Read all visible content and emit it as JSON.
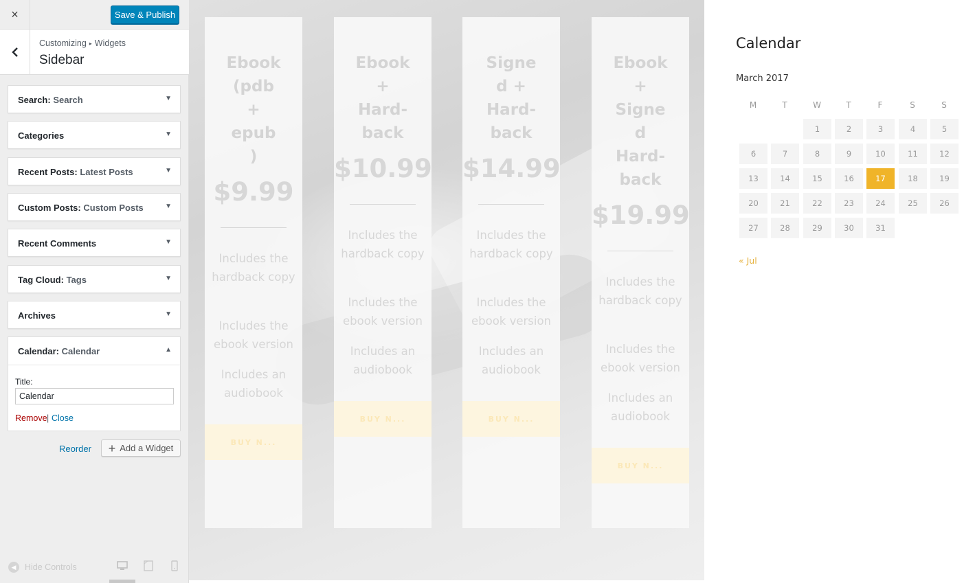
{
  "header": {
    "close_icon": "×",
    "publish_label": "Save & Publish"
  },
  "section": {
    "breadcrumb_root": "Customizing",
    "breadcrumb_sep": "▸",
    "breadcrumb_current": "Widgets",
    "title": "Sidebar"
  },
  "widgets": [
    {
      "name": "Search",
      "sub": "Search"
    },
    {
      "name": "Categories",
      "sub": ""
    },
    {
      "name": "Recent Posts",
      "sub": "Latest Posts"
    },
    {
      "name": "Custom Posts",
      "sub": "Custom Posts"
    },
    {
      "name": "Recent Comments",
      "sub": ""
    },
    {
      "name": "Tag Cloud",
      "sub": "Tags"
    },
    {
      "name": "Archives",
      "sub": ""
    }
  ],
  "calendar_widget": {
    "name": "Calendar",
    "sub": "Calendar",
    "title_label": "Title:",
    "title_value": "Calendar",
    "remove_label": "Remove",
    "link_sep": "|",
    "close_label": "Close"
  },
  "actions": {
    "reorder_label": "Reorder",
    "add_widget_label": "Add a Widget"
  },
  "footer": {
    "hide_controls_label": "Hide Controls"
  },
  "pricing": [
    {
      "lines": [
        "Ebook",
        "(pdb",
        "+",
        "epub",
        ")"
      ],
      "price": "$9.99",
      "features": [
        "Includes the hardback copy",
        "Includes the ebook version",
        "Includes an audiobook"
      ],
      "buy": "BUY N..."
    },
    {
      "lines": [
        "Ebook",
        "+",
        "Hard-",
        "back"
      ],
      "price": "$10.99",
      "features": [
        "Includes the hardback copy",
        "Includes the ebook version",
        "Includes an audiobook"
      ],
      "buy": "BUY N..."
    },
    {
      "lines": [
        "Signe",
        "d +",
        "Hard-",
        "back"
      ],
      "price": "$14.99",
      "features": [
        "Includes the hardback copy",
        "Includes the ebook version",
        "Includes an audiobook"
      ],
      "buy": "BUY N..."
    },
    {
      "lines": [
        "Ebook",
        "+",
        "Signe",
        "d",
        "Hard-",
        "back"
      ],
      "price": "$19.99",
      "features": [
        "Includes the hardback copy",
        "Includes the ebook version",
        "Includes an audiobook"
      ],
      "buy": "BUY N..."
    }
  ],
  "calendar": {
    "heading": "Calendar",
    "month": "March 2017",
    "weekdays": [
      "M",
      "T",
      "W",
      "T",
      "F",
      "S",
      "S"
    ],
    "first_weekday_index": 2,
    "days_in_month": 31,
    "today": 17,
    "today_color": "#f0b429",
    "prev_link": "« Jul"
  },
  "colors": {
    "accent": "#0085ba",
    "link": "#0073aa",
    "remove": "#aa0000"
  }
}
